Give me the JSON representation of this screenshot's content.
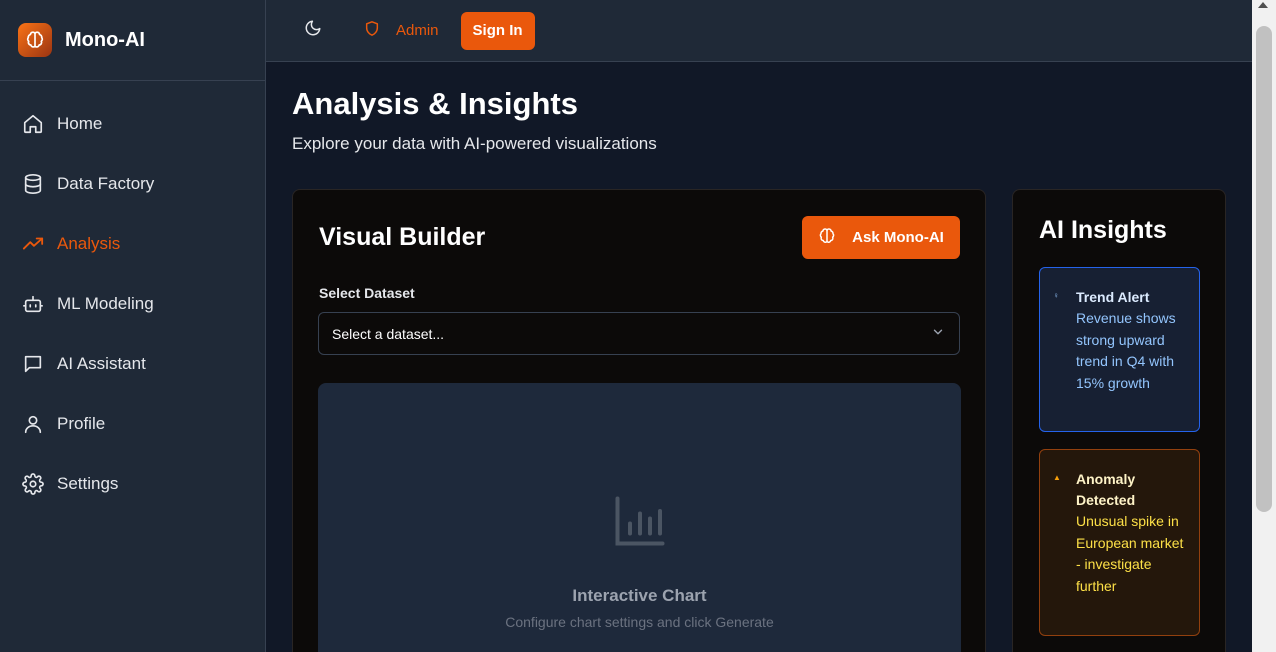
{
  "app": {
    "name": "Mono-AI"
  },
  "sidebar": {
    "items": [
      {
        "label": "Home",
        "icon": "home-icon",
        "active": false
      },
      {
        "label": "Data Factory",
        "icon": "database-icon",
        "active": false
      },
      {
        "label": "Analysis",
        "icon": "trending-up-icon",
        "active": true
      },
      {
        "label": "ML Modeling",
        "icon": "bot-icon",
        "active": false
      },
      {
        "label": "AI Assistant",
        "icon": "chat-icon",
        "active": false
      },
      {
        "label": "Profile",
        "icon": "user-icon",
        "active": false
      },
      {
        "label": "Settings",
        "icon": "gear-icon",
        "active": false
      }
    ]
  },
  "topbar": {
    "admin_label": "Admin",
    "signin_label": "Sign In"
  },
  "page": {
    "title": "Analysis & Insights",
    "subtitle": "Explore your data with AI-powered visualizations"
  },
  "builder": {
    "title": "Visual Builder",
    "ask_label": "Ask Mono-AI",
    "dataset_label": "Select Dataset",
    "dataset_placeholder": "Select a dataset...",
    "chart_title": "Interactive Chart",
    "chart_hint": "Configure chart settings and click Generate"
  },
  "insights": {
    "title": "AI Insights",
    "items": [
      {
        "title": "Trend Alert",
        "body": "Revenue shows strong upward trend in Q4 with 15% growth",
        "tone": "blue"
      },
      {
        "title": "Anomaly Detected",
        "body": "Unusual spike in European market - investigate further",
        "tone": "amber"
      }
    ]
  },
  "colors": {
    "accent": "#ea580c",
    "sidebar_bg": "#1f2937",
    "page_bg": "#111827",
    "card_bg": "#0c0a09"
  }
}
